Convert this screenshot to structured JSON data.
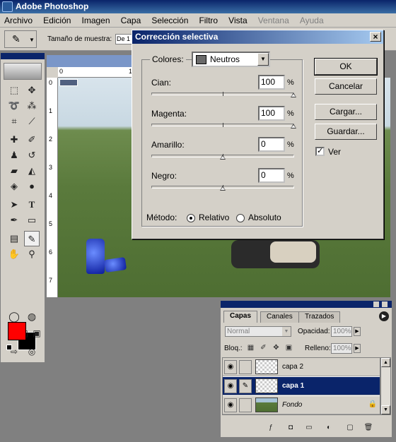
{
  "app": {
    "title": "Adobe Photoshop"
  },
  "menu": [
    "Archivo",
    "Edición",
    "Imagen",
    "Capa",
    "Selección",
    "Filtro",
    "Vista",
    "Ventana",
    "Ayuda"
  ],
  "options_bar": {
    "sample_size_label": "Tamaño de muestra:",
    "sample_size_value": "De 1"
  },
  "document": {
    "ruler_top": [
      "0",
      "1"
    ],
    "ruler_left": [
      "0",
      "1",
      "2",
      "3",
      "4",
      "5",
      "6",
      "7"
    ]
  },
  "dialog": {
    "title": "Corrección selectiva",
    "colors_label": "Colores:",
    "colors_value": "Neutros",
    "sliders": [
      {
        "label": "Cian:",
        "value": "100",
        "percent": "%",
        "level": 100
      },
      {
        "label": "Magenta:",
        "value": "100",
        "percent": "%",
        "level": 100
      },
      {
        "label": "Amarillo:",
        "value": "0",
        "percent": "%",
        "level": 0
      },
      {
        "label": "Negro:",
        "value": "0",
        "percent": "%",
        "level": 0
      }
    ],
    "method_label": "Método:",
    "method_options": [
      "Relativo",
      "Absoluto"
    ],
    "method_selected": "Relativo",
    "buttons": {
      "ok": "OK",
      "cancel": "Cancelar",
      "load": "Cargar...",
      "save": "Guardar..."
    },
    "preview_label": "Ver",
    "preview_checked": true
  },
  "layers_panel": {
    "tabs": [
      "Capas",
      "Canales",
      "Trazados"
    ],
    "active_tab": "Capas",
    "blend_mode": "Normal",
    "opacity_label": "Opacidad:",
    "opacity_value": "100%",
    "lock_label": "Bloq.:",
    "fill_label": "Relleno:",
    "fill_value": "100%",
    "layers": [
      {
        "name": "capa 2",
        "selected": false
      },
      {
        "name": "capa 1",
        "selected": true
      },
      {
        "name": "Fondo",
        "selected": false,
        "locked": true
      }
    ]
  },
  "colors": {
    "foreground": "#ff0000",
    "background": "#000000",
    "title_bar": "#0a246a",
    "selected_layer": "#0a246a"
  },
  "icons": [
    "move-icon",
    "marquee-icon",
    "lasso-icon",
    "magic-wand-icon",
    "crop-icon",
    "slice-icon",
    "healing-icon",
    "brush-icon",
    "stamp-icon",
    "history-brush-icon",
    "eraser-icon",
    "bucket-icon",
    "blur-icon",
    "dodge-icon",
    "path-select-icon",
    "type-icon",
    "pen-icon",
    "shape-icon",
    "notes-icon",
    "eyedropper-icon",
    "hand-icon",
    "zoom-icon"
  ]
}
